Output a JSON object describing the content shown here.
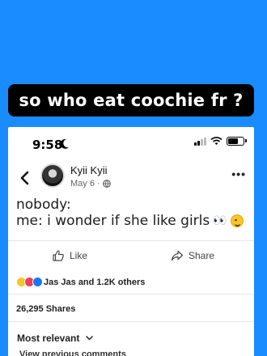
{
  "caption": "so who eat coochie fr ?",
  "status_bar": {
    "time": "9:58"
  },
  "post": {
    "author": "Kyii Kyii",
    "date": "May 6 ·",
    "line1": "nobody:",
    "line2": "me: i wonder if she like girls",
    "eyes_emoji": "👀"
  },
  "actions": {
    "like": "Like",
    "share": "Share"
  },
  "reactions": {
    "text": "Jas Jas and 1.2K others"
  },
  "shares": "26,295 Shares",
  "sort": "Most relevant",
  "view_previous": "View previous comments",
  "colors": {
    "background": "#1a8cff",
    "caption_bg": "#000000",
    "panel": "#ffffff"
  }
}
